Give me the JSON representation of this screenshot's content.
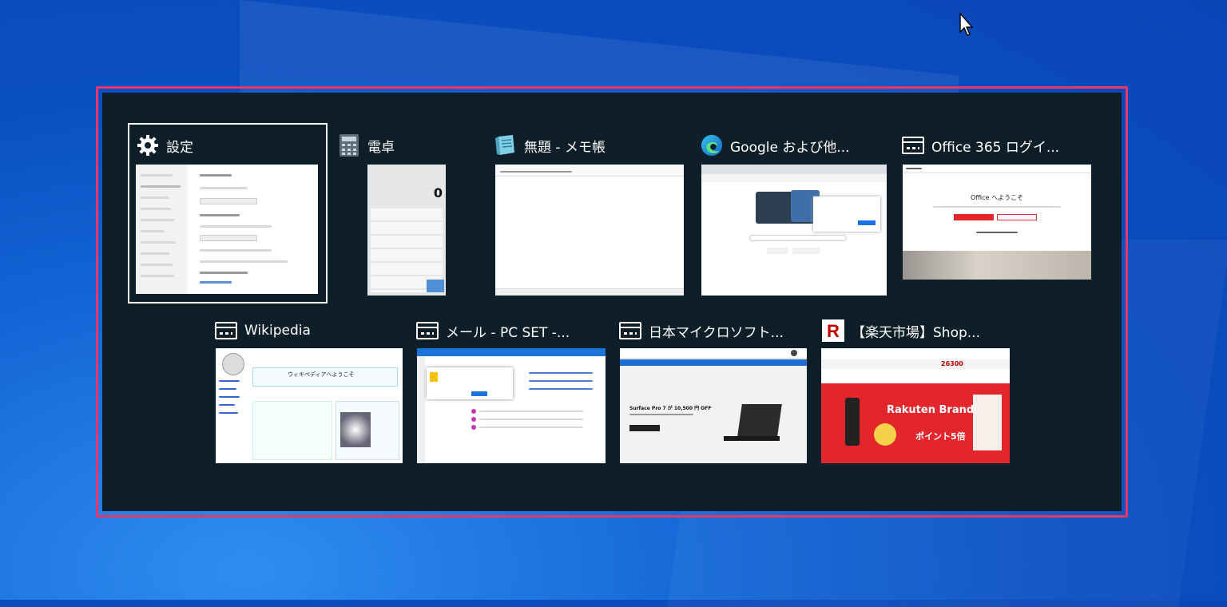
{
  "switcher": {
    "windows": [
      {
        "title": "設定",
        "icon": "gear-icon"
      },
      {
        "title": "電卓",
        "icon": "calculator-icon"
      },
      {
        "title": "無題 - メモ帳",
        "icon": "notepad-icon"
      },
      {
        "title": "Google および他...",
        "icon": "edge-icon"
      },
      {
        "title": "Office 365 ログイ...",
        "icon": "window-icon"
      },
      {
        "title": "Wikipedia",
        "icon": "window-icon"
      },
      {
        "title": "メール - PC SET -...",
        "icon": "window-icon"
      },
      {
        "title": "日本マイクロソフト...",
        "icon": "window-icon"
      },
      {
        "title": "【楽天市場】Shop...",
        "icon": "rakuten-icon"
      }
    ],
    "selected_title": "設定"
  },
  "thumbnails": {
    "calculator_display": "0",
    "office_heading": "Office へようこそ",
    "wikipedia_heading": "ウィキペディアへようこそ",
    "surface_promo": "Surface Pro 7 が 10,500 円 OFF",
    "rakuten_banner": "Rakuten Brand Day",
    "rakuten_points": "ポイント5倍",
    "rakuten_count": "26300"
  },
  "colors": {
    "highlight_border": "#e8366b",
    "switcher_bg": "#0f1f2a",
    "desktop_blue": "#0b57c9",
    "rakuten_red": "#e3262c"
  }
}
